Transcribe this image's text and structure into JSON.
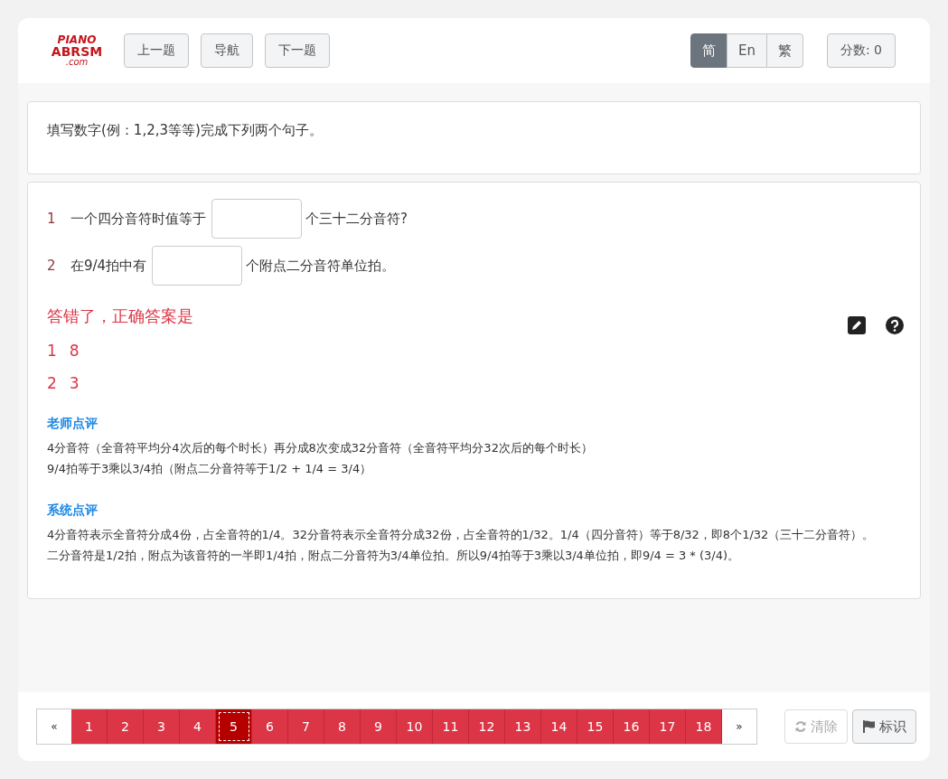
{
  "header": {
    "logo": {
      "line1": "PIANO",
      "line2": "ABRSM",
      "line3": ".com"
    },
    "nav_buttons": [
      "上一题",
      "导航",
      "下一题"
    ],
    "languages": [
      {
        "label": "简",
        "selected": true
      },
      {
        "label": "En",
        "selected": false
      },
      {
        "label": "繁",
        "selected": false
      }
    ],
    "score": "分数: 0"
  },
  "instruction": "填写数字(例：1,2,3等等)完成下列两个句子。",
  "questions": [
    {
      "number": "1",
      "before": "一个四分音符时值等于",
      "after": "个三十二分音符?"
    },
    {
      "number": "2",
      "before": "在9/4拍中有",
      "after": "个附点二分音符单位拍。"
    }
  ],
  "result": {
    "message": "答错了，正确答案是",
    "answers": [
      {
        "number": "1",
        "value": "8"
      },
      {
        "number": "2",
        "value": "3"
      }
    ]
  },
  "comments": [
    {
      "title": "老师点评",
      "lines": [
        "4分音符（全音符平均分4次后的每个时长）再分成8次变成32分音符（全音符平均分32次后的每个时长）",
        "9/4拍等于3乘以3/4拍（附点二分音符等于1/2 + 1/4 = 3/4）"
      ]
    },
    {
      "title": "系统点评",
      "lines": [
        "4分音符表示全音符分成4份，占全音符的1/4。32分音符表示全音符分成32份，占全音符的1/32。1/4（四分音符）等于8/32，即8个1/32（三十二分音符）。",
        "二分音符是1/2拍，附点为该音符的一半即1/4拍，附点二分音符为3/4单位拍。所以9/4拍等于3乘以3/4单位拍，即9/4 = 3 * (3/4)。"
      ]
    }
  ],
  "pagination": {
    "prev": "«",
    "next": "»",
    "pages": [
      {
        "label": "1",
        "selected": false
      },
      {
        "label": "2",
        "selected": false
      },
      {
        "label": "3",
        "selected": false
      },
      {
        "label": "4",
        "selected": false
      },
      {
        "label": "5",
        "selected": true
      },
      {
        "label": "6",
        "selected": false
      },
      {
        "label": "7",
        "selected": false
      },
      {
        "label": "8",
        "selected": false
      },
      {
        "label": "9",
        "selected": false
      },
      {
        "label": "10",
        "selected": false
      },
      {
        "label": "11",
        "selected": false
      },
      {
        "label": "12",
        "selected": false
      },
      {
        "label": "13",
        "selected": false
      },
      {
        "label": "14",
        "selected": false
      },
      {
        "label": "15",
        "selected": false
      },
      {
        "label": "16",
        "selected": false
      },
      {
        "label": "17",
        "selected": false
      },
      {
        "label": "18",
        "selected": false
      }
    ]
  },
  "actions": [
    {
      "label": "清除",
      "kind": "clear",
      "disabled": true
    },
    {
      "label": "标识",
      "kind": "flag",
      "disabled": false
    }
  ]
}
